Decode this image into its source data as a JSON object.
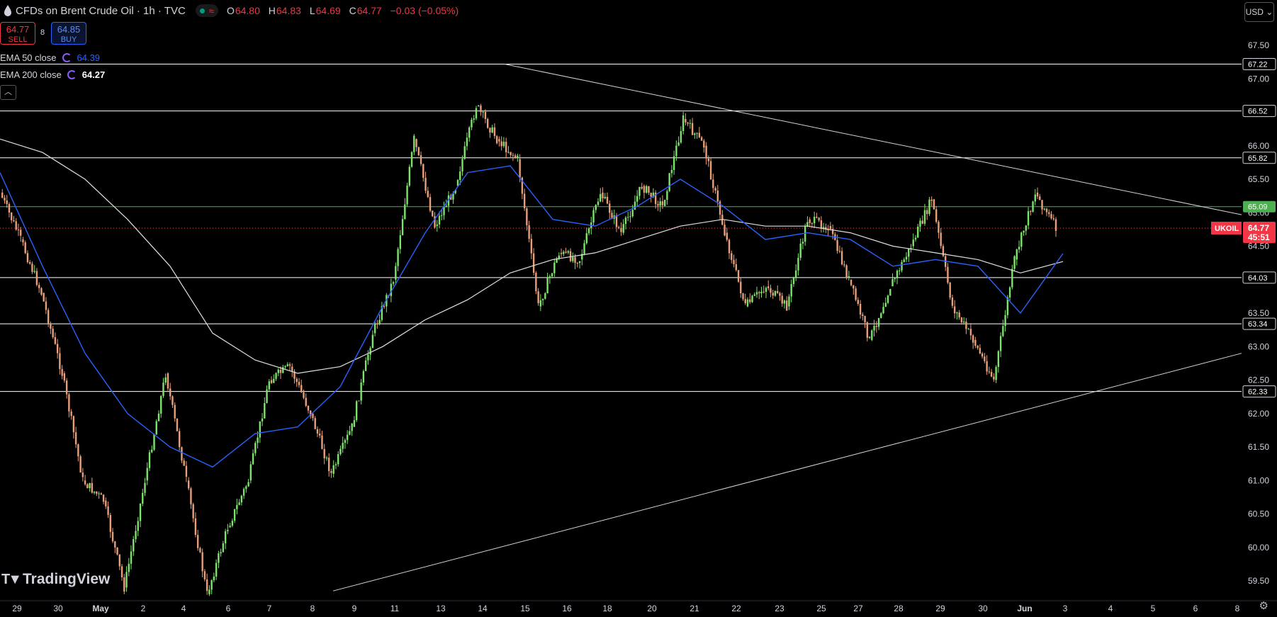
{
  "header": {
    "symbol_title": "CFDs on Brent Crude Oil · 1h · TVC",
    "open_label": "O",
    "open": "64.80",
    "high_label": "H",
    "high": "64.83",
    "low_label": "L",
    "low": "64.69",
    "close_label": "C",
    "close": "64.77",
    "change": "−0.03 (−0.05%)",
    "status_colors": [
      "#089981",
      "#f23645"
    ]
  },
  "trade": {
    "sell_price": "64.77",
    "sell_label": "SELL",
    "spread": "8",
    "buy_price": "64.85",
    "buy_label": "BUY"
  },
  "indicators": [
    {
      "label": "EMA 50 close",
      "value": "64.39",
      "color": "#2962ff"
    },
    {
      "label": "EMA 200 close",
      "value": "64.27",
      "color": "#ffffff"
    }
  ],
  "collapse_icon": "chevron-up-icon",
  "currency": "USD",
  "logo_text": "TradingView",
  "colors": {
    "up": "#089981",
    "down": "#f23645",
    "ema50": "#2962ff",
    "ema200": "#e0e0e0",
    "level": "#ffffff",
    "highlight_level": "#4caf50",
    "price_line": "#f23645"
  },
  "chart_data": {
    "type": "candlestick",
    "title": "CFDs on Brent Crude Oil · 1h · TVC",
    "ylim": [
      59.2,
      68.1
    ],
    "y_ticks": [
      59.5,
      60.0,
      60.5,
      61.0,
      61.5,
      62.0,
      62.5,
      63.0,
      63.5,
      64.0,
      64.5,
      65.0,
      65.5,
      66.0,
      66.5,
      67.0,
      67.5
    ],
    "x_ticks": [
      "29",
      "30",
      "May",
      "2",
      "4",
      "6",
      "7",
      "8",
      "9",
      "11",
      "13",
      "14",
      "15",
      "16",
      "18",
      "20",
      "21",
      "22",
      "23",
      "25",
      "27",
      "28",
      "29",
      "30",
      "Jun",
      "3",
      "4",
      "5",
      "6",
      "8"
    ],
    "horizontal_levels": [
      {
        "value": 67.22,
        "label": "67.22"
      },
      {
        "value": 66.52,
        "label": "66.52"
      },
      {
        "value": 65.82,
        "label": "65.82"
      },
      {
        "value": 65.09,
        "label": "65.09",
        "highlight": true
      },
      {
        "value": 64.03,
        "label": "64.03"
      },
      {
        "value": 63.34,
        "label": "63.34"
      },
      {
        "value": 62.33,
        "label": "62.33"
      }
    ],
    "last_price": {
      "symbol": "UKOIL",
      "value": "64.77",
      "countdown": "45:51"
    },
    "trendlines": [
      {
        "name": "descending-resistance",
        "from": {
          "x": "13",
          "y": 67.22
        },
        "to": {
          "x": "8",
          "y": 64.97
        }
      },
      {
        "name": "ascending-support",
        "from": {
          "x": "8",
          "y": 59.2
        },
        "to": {
          "x": "8",
          "y": 62.9
        }
      }
    ],
    "price_path": [
      {
        "x": "29",
        "y": 65.3
      },
      {
        "x": "29",
        "y": 64.6
      },
      {
        "x": "30",
        "y": 63.8
      },
      {
        "x": "30",
        "y": 62.6
      },
      {
        "x": "May",
        "y": 61.0
      },
      {
        "x": "May",
        "y": 60.7
      },
      {
        "x": "2",
        "y": 59.4
      },
      {
        "x": "2",
        "y": 61.0
      },
      {
        "x": "2",
        "y": 62.6
      },
      {
        "x": "4",
        "y": 61.0
      },
      {
        "x": "4",
        "y": 59.3
      },
      {
        "x": "6",
        "y": 60.3
      },
      {
        "x": "6",
        "y": 61.0
      },
      {
        "x": "7",
        "y": 62.5
      },
      {
        "x": "7",
        "y": 62.7
      },
      {
        "x": "8",
        "y": 62.0
      },
      {
        "x": "8",
        "y": 61.1
      },
      {
        "x": "9",
        "y": 61.8
      },
      {
        "x": "9",
        "y": 63.2
      },
      {
        "x": "11",
        "y": 64.0
      },
      {
        "x": "11",
        "y": 66.1
      },
      {
        "x": "13",
        "y": 64.8
      },
      {
        "x": "13",
        "y": 65.4
      },
      {
        "x": "14",
        "y": 66.6
      },
      {
        "x": "14",
        "y": 66.1
      },
      {
        "x": "15",
        "y": 65.8
      },
      {
        "x": "15",
        "y": 63.6
      },
      {
        "x": "16",
        "y": 64.4
      },
      {
        "x": "16",
        "y": 64.3
      },
      {
        "x": "18",
        "y": 65.3
      },
      {
        "x": "18",
        "y": 64.7
      },
      {
        "x": "20",
        "y": 65.4
      },
      {
        "x": "20",
        "y": 65.1
      },
      {
        "x": "21",
        "y": 66.4
      },
      {
        "x": "21",
        "y": 66.0
      },
      {
        "x": "22",
        "y": 64.7
      },
      {
        "x": "22",
        "y": 63.6
      },
      {
        "x": "23",
        "y": 63.9
      },
      {
        "x": "23",
        "y": 63.6
      },
      {
        "x": "25",
        "y": 64.9
      },
      {
        "x": "25",
        "y": 64.8
      },
      {
        "x": "27",
        "y": 64.0
      },
      {
        "x": "28",
        "y": 63.1
      },
      {
        "x": "28",
        "y": 63.9
      },
      {
        "x": "29",
        "y": 64.5
      },
      {
        "x": "29",
        "y": 65.2
      },
      {
        "x": "30",
        "y": 63.6
      },
      {
        "x": "30",
        "y": 63.1
      },
      {
        "x": "Jun",
        "y": 62.5
      },
      {
        "x": "Jun",
        "y": 64.3
      },
      {
        "x": "3",
        "y": 65.3
      },
      {
        "x": "3",
        "y": 64.77
      }
    ],
    "ema50_path": [
      {
        "x": "29",
        "y": 65.6
      },
      {
        "x": "30",
        "y": 64.2
      },
      {
        "x": "May",
        "y": 62.9
      },
      {
        "x": "2",
        "y": 62.0
      },
      {
        "x": "4",
        "y": 61.5
      },
      {
        "x": "6",
        "y": 61.2
      },
      {
        "x": "7",
        "y": 61.7
      },
      {
        "x": "8",
        "y": 61.8
      },
      {
        "x": "9",
        "y": 62.4
      },
      {
        "x": "11",
        "y": 63.6
      },
      {
        "x": "13",
        "y": 64.7
      },
      {
        "x": "14",
        "y": 65.6
      },
      {
        "x": "15",
        "y": 65.7
      },
      {
        "x": "16",
        "y": 64.9
      },
      {
        "x": "18",
        "y": 64.8
      },
      {
        "x": "20",
        "y": 65.1
      },
      {
        "x": "21",
        "y": 65.5
      },
      {
        "x": "22",
        "y": 65.1
      },
      {
        "x": "23",
        "y": 64.6
      },
      {
        "x": "25",
        "y": 64.7
      },
      {
        "x": "27",
        "y": 64.6
      },
      {
        "x": "28",
        "y": 64.2
      },
      {
        "x": "29",
        "y": 64.3
      },
      {
        "x": "30",
        "y": 64.2
      },
      {
        "x": "Jun",
        "y": 63.5
      },
      {
        "x": "3",
        "y": 64.39
      }
    ],
    "ema200_path": [
      {
        "x": "29",
        "y": 66.1
      },
      {
        "x": "30",
        "y": 65.9
      },
      {
        "x": "May",
        "y": 65.5
      },
      {
        "x": "2",
        "y": 64.9
      },
      {
        "x": "4",
        "y": 64.2
      },
      {
        "x": "6",
        "y": 63.2
      },
      {
        "x": "7",
        "y": 62.8
      },
      {
        "x": "8",
        "y": 62.6
      },
      {
        "x": "9",
        "y": 62.7
      },
      {
        "x": "11",
        "y": 63.0
      },
      {
        "x": "13",
        "y": 63.4
      },
      {
        "x": "14",
        "y": 63.7
      },
      {
        "x": "15",
        "y": 64.1
      },
      {
        "x": "16",
        "y": 64.3
      },
      {
        "x": "18",
        "y": 64.4
      },
      {
        "x": "20",
        "y": 64.6
      },
      {
        "x": "21",
        "y": 64.8
      },
      {
        "x": "22",
        "y": 64.9
      },
      {
        "x": "23",
        "y": 64.8
      },
      {
        "x": "25",
        "y": 64.8
      },
      {
        "x": "27",
        "y": 64.7
      },
      {
        "x": "28",
        "y": 64.5
      },
      {
        "x": "29",
        "y": 64.4
      },
      {
        "x": "30",
        "y": 64.3
      },
      {
        "x": "Jun",
        "y": 64.1
      },
      {
        "x": "3",
        "y": 64.27
      }
    ]
  }
}
